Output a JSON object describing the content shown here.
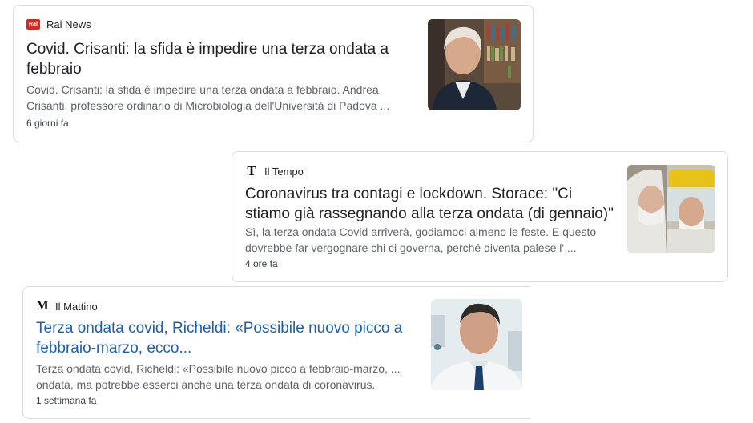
{
  "articles": [
    {
      "source": "Rai News",
      "source_logo": "Rai",
      "title": "Covid. Crisanti: la sfida è impedire una terza ondata a febbraio",
      "snippet": "Covid. Crisanti: la sfida è impedire una terza ondata a febbraio. Andrea Crisanti, professore ordinario di Microbiologia dell'Università di Padova ...",
      "time": "6 giorni fa",
      "thumbnail": "man-in-front-of-bookshelf-photo"
    },
    {
      "source": "Il Tempo",
      "source_logo": "T",
      "title": "Coronavirus tra contagi e lockdown. Storace: \"Ci stiamo già rassegnando alla terza ondata (di gennaio)\"",
      "snippet": "Sì, la terza ondata Covid arriverà, godiamoci almeno le feste. E questo dovrebbe far vergognare chi ci governa, perché diventa palese l' ...",
      "time": "4 ore fa",
      "thumbnail": "health-workers-in-protective-gear-photo"
    },
    {
      "source": "Il Mattino",
      "source_logo": "M",
      "title": "Terza ondata covid, Richeldi: «Possibile nuovo picco a febbraio-marzo, ecco...",
      "snippet": "Terza ondata covid, Richeldi: «Possibile nuovo picco a febbraio-marzo, ... ondata, ma potrebbe esserci anche una terza ondata di coronavirus.",
      "time": "1 settimana fa",
      "thumbnail": "doctor-in-white-coat-photo"
    }
  ]
}
